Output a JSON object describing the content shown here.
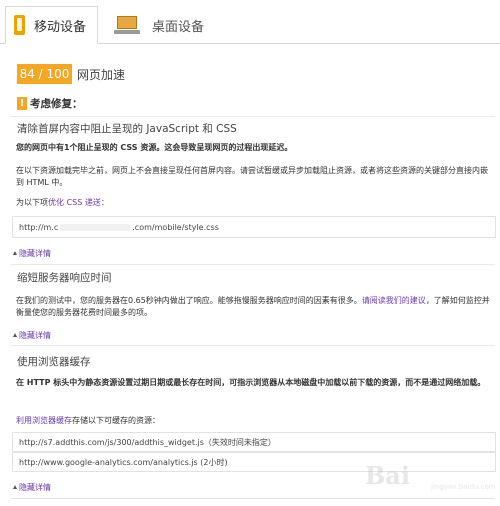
{
  "tabs": [
    {
      "label": "移动设备",
      "icon": "phone-icon",
      "active": true
    },
    {
      "label": "桌面设备",
      "icon": "monitor-icon",
      "active": false
    }
  ],
  "score": {
    "value": "84 / 100",
    "label": "网页加速"
  },
  "consider_fixing": {
    "marker": "!",
    "title": "考虑修复："
  },
  "sections": [
    {
      "title": "清除首屏内容中阻止呈现的 JavaScript 和 CSS",
      "summary": "您的网页中有1个阻止呈现的 CSS 资源。这会导致呈现网页的过程出现延迟。",
      "detail": "在以下资源加载完毕之前，网页上不会直接呈现任何首屏内容。请尝试暂缓或异步加载阻止资源，或者将这些资源的关键部分直接内嵌到 HTML 中。",
      "prompt_prefix": "为以下项",
      "prompt_link": "优化 CSS 递送",
      "prompt_suffix": "：",
      "resources": [
        {
          "prefix": "http://m.c",
          "suffix": ".com/mobile/style.css"
        }
      ],
      "hide_label": "隐藏详情"
    },
    {
      "title": "缩短服务器响应时间",
      "detail_prefix": "在我们的测试中，您的服务器在0.65秒钟内做出了响应。能够拖慢服务器响应时间的因素有很多。",
      "detail_link": "请阅读我们的建议",
      "detail_suffix": "，了解如何监控并衡量使您的服务器花费时间最多的项。",
      "hide_label": "隐藏详情"
    },
    {
      "title": "使用浏览器缓存",
      "summary": "在 HTTP 标头中为静态资源设置过期日期或最长存在时间，可指示浏览器从本地磁盘中加载以前下载的资源，而不是通过网络加载。",
      "prompt_link": "利用浏览器缓存",
      "prompt_suffix": "存储以下可缓存的资源：",
      "resources": [
        "http://s7.addthis.com/js/300/addthis_widget.js（失效时间未指定）",
        "http://www.google-analytics.com/analytics.js (2小时)"
      ],
      "hide_label": "隐藏详情"
    }
  ],
  "watermark": {
    "text": "Bai",
    "sub": "jingyan.baidu.com"
  },
  "colors": {
    "accent": "#f5a623",
    "link": "#6a36b5"
  }
}
